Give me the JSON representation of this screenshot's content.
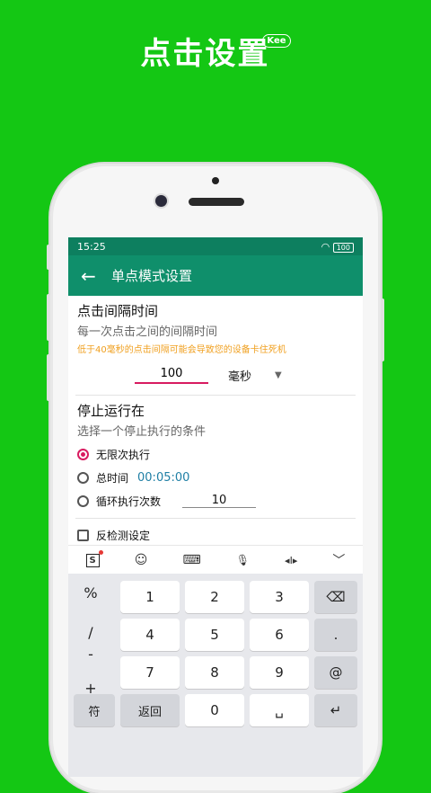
{
  "hero_title": "点击设置",
  "hero_badge": "Kee",
  "status": {
    "time": "15:25",
    "battery": "100"
  },
  "appbar": {
    "back_icon": "←",
    "title": "单点模式设置"
  },
  "interval": {
    "heading": "点击间隔时间",
    "sub": "每一次点击之间的间隔时间",
    "warning": "低于40毫秒的点击间隔可能会导致您的设备卡住死机",
    "value": "100",
    "unit": "毫秒",
    "caret": "▼"
  },
  "stop": {
    "heading": "停止运行在",
    "sub": "选择一个停止执行的条件",
    "options": [
      {
        "label": "无限次执行",
        "selected": true
      },
      {
        "label": "总时间",
        "value": "00:05:00"
      },
      {
        "label": "循环执行次数",
        "value": "10"
      }
    ]
  },
  "anti_detect": {
    "label": "反检测设定"
  },
  "kb_toolbar": {
    "sogou": "S",
    "emoji": "☺",
    "keyboard": "⌨",
    "mic": "🎙",
    "cursor": "◂I▸",
    "collapse": "﹀"
  },
  "keyboard": {
    "symbols": [
      "%",
      "/",
      "-",
      "+"
    ],
    "digits": [
      "1",
      "2",
      "3",
      "4",
      "5",
      "6",
      "7",
      "8",
      "9",
      "0"
    ],
    "backspace": "⌫",
    "dot": ".",
    "at": "@",
    "sym_key": "符",
    "back_key": "返回",
    "space": "␣",
    "enter": "↵"
  }
}
